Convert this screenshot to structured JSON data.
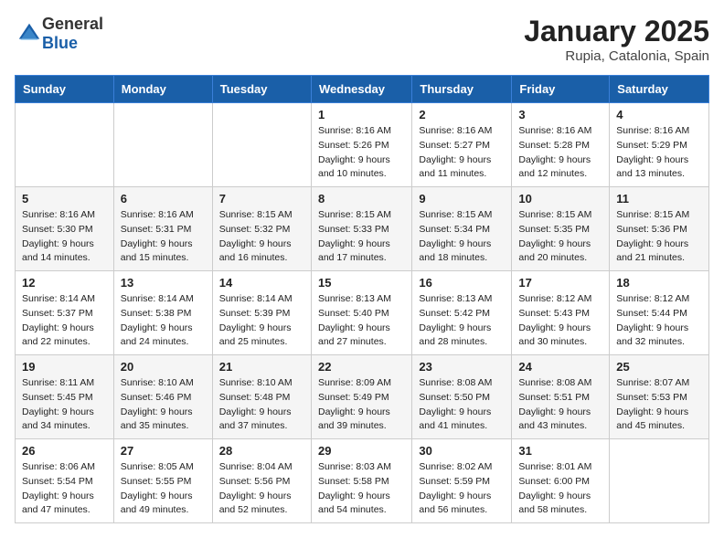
{
  "header": {
    "logo_general": "General",
    "logo_blue": "Blue",
    "title": "January 2025",
    "subtitle": "Rupia, Catalonia, Spain"
  },
  "weekdays": [
    "Sunday",
    "Monday",
    "Tuesday",
    "Wednesday",
    "Thursday",
    "Friday",
    "Saturday"
  ],
  "weeks": [
    [
      {
        "day": "",
        "info": ""
      },
      {
        "day": "",
        "info": ""
      },
      {
        "day": "",
        "info": ""
      },
      {
        "day": "1",
        "info": "Sunrise: 8:16 AM\nSunset: 5:26 PM\nDaylight: 9 hours\nand 10 minutes."
      },
      {
        "day": "2",
        "info": "Sunrise: 8:16 AM\nSunset: 5:27 PM\nDaylight: 9 hours\nand 11 minutes."
      },
      {
        "day": "3",
        "info": "Sunrise: 8:16 AM\nSunset: 5:28 PM\nDaylight: 9 hours\nand 12 minutes."
      },
      {
        "day": "4",
        "info": "Sunrise: 8:16 AM\nSunset: 5:29 PM\nDaylight: 9 hours\nand 13 minutes."
      }
    ],
    [
      {
        "day": "5",
        "info": "Sunrise: 8:16 AM\nSunset: 5:30 PM\nDaylight: 9 hours\nand 14 minutes."
      },
      {
        "day": "6",
        "info": "Sunrise: 8:16 AM\nSunset: 5:31 PM\nDaylight: 9 hours\nand 15 minutes."
      },
      {
        "day": "7",
        "info": "Sunrise: 8:15 AM\nSunset: 5:32 PM\nDaylight: 9 hours\nand 16 minutes."
      },
      {
        "day": "8",
        "info": "Sunrise: 8:15 AM\nSunset: 5:33 PM\nDaylight: 9 hours\nand 17 minutes."
      },
      {
        "day": "9",
        "info": "Sunrise: 8:15 AM\nSunset: 5:34 PM\nDaylight: 9 hours\nand 18 minutes."
      },
      {
        "day": "10",
        "info": "Sunrise: 8:15 AM\nSunset: 5:35 PM\nDaylight: 9 hours\nand 20 minutes."
      },
      {
        "day": "11",
        "info": "Sunrise: 8:15 AM\nSunset: 5:36 PM\nDaylight: 9 hours\nand 21 minutes."
      }
    ],
    [
      {
        "day": "12",
        "info": "Sunrise: 8:14 AM\nSunset: 5:37 PM\nDaylight: 9 hours\nand 22 minutes."
      },
      {
        "day": "13",
        "info": "Sunrise: 8:14 AM\nSunset: 5:38 PM\nDaylight: 9 hours\nand 24 minutes."
      },
      {
        "day": "14",
        "info": "Sunrise: 8:14 AM\nSunset: 5:39 PM\nDaylight: 9 hours\nand 25 minutes."
      },
      {
        "day": "15",
        "info": "Sunrise: 8:13 AM\nSunset: 5:40 PM\nDaylight: 9 hours\nand 27 minutes."
      },
      {
        "day": "16",
        "info": "Sunrise: 8:13 AM\nSunset: 5:42 PM\nDaylight: 9 hours\nand 28 minutes."
      },
      {
        "day": "17",
        "info": "Sunrise: 8:12 AM\nSunset: 5:43 PM\nDaylight: 9 hours\nand 30 minutes."
      },
      {
        "day": "18",
        "info": "Sunrise: 8:12 AM\nSunset: 5:44 PM\nDaylight: 9 hours\nand 32 minutes."
      }
    ],
    [
      {
        "day": "19",
        "info": "Sunrise: 8:11 AM\nSunset: 5:45 PM\nDaylight: 9 hours\nand 34 minutes."
      },
      {
        "day": "20",
        "info": "Sunrise: 8:10 AM\nSunset: 5:46 PM\nDaylight: 9 hours\nand 35 minutes."
      },
      {
        "day": "21",
        "info": "Sunrise: 8:10 AM\nSunset: 5:48 PM\nDaylight: 9 hours\nand 37 minutes."
      },
      {
        "day": "22",
        "info": "Sunrise: 8:09 AM\nSunset: 5:49 PM\nDaylight: 9 hours\nand 39 minutes."
      },
      {
        "day": "23",
        "info": "Sunrise: 8:08 AM\nSunset: 5:50 PM\nDaylight: 9 hours\nand 41 minutes."
      },
      {
        "day": "24",
        "info": "Sunrise: 8:08 AM\nSunset: 5:51 PM\nDaylight: 9 hours\nand 43 minutes."
      },
      {
        "day": "25",
        "info": "Sunrise: 8:07 AM\nSunset: 5:53 PM\nDaylight: 9 hours\nand 45 minutes."
      }
    ],
    [
      {
        "day": "26",
        "info": "Sunrise: 8:06 AM\nSunset: 5:54 PM\nDaylight: 9 hours\nand 47 minutes."
      },
      {
        "day": "27",
        "info": "Sunrise: 8:05 AM\nSunset: 5:55 PM\nDaylight: 9 hours\nand 49 minutes."
      },
      {
        "day": "28",
        "info": "Sunrise: 8:04 AM\nSunset: 5:56 PM\nDaylight: 9 hours\nand 52 minutes."
      },
      {
        "day": "29",
        "info": "Sunrise: 8:03 AM\nSunset: 5:58 PM\nDaylight: 9 hours\nand 54 minutes."
      },
      {
        "day": "30",
        "info": "Sunrise: 8:02 AM\nSunset: 5:59 PM\nDaylight: 9 hours\nand 56 minutes."
      },
      {
        "day": "31",
        "info": "Sunrise: 8:01 AM\nSunset: 6:00 PM\nDaylight: 9 hours\nand 58 minutes."
      },
      {
        "day": "",
        "info": ""
      }
    ]
  ]
}
